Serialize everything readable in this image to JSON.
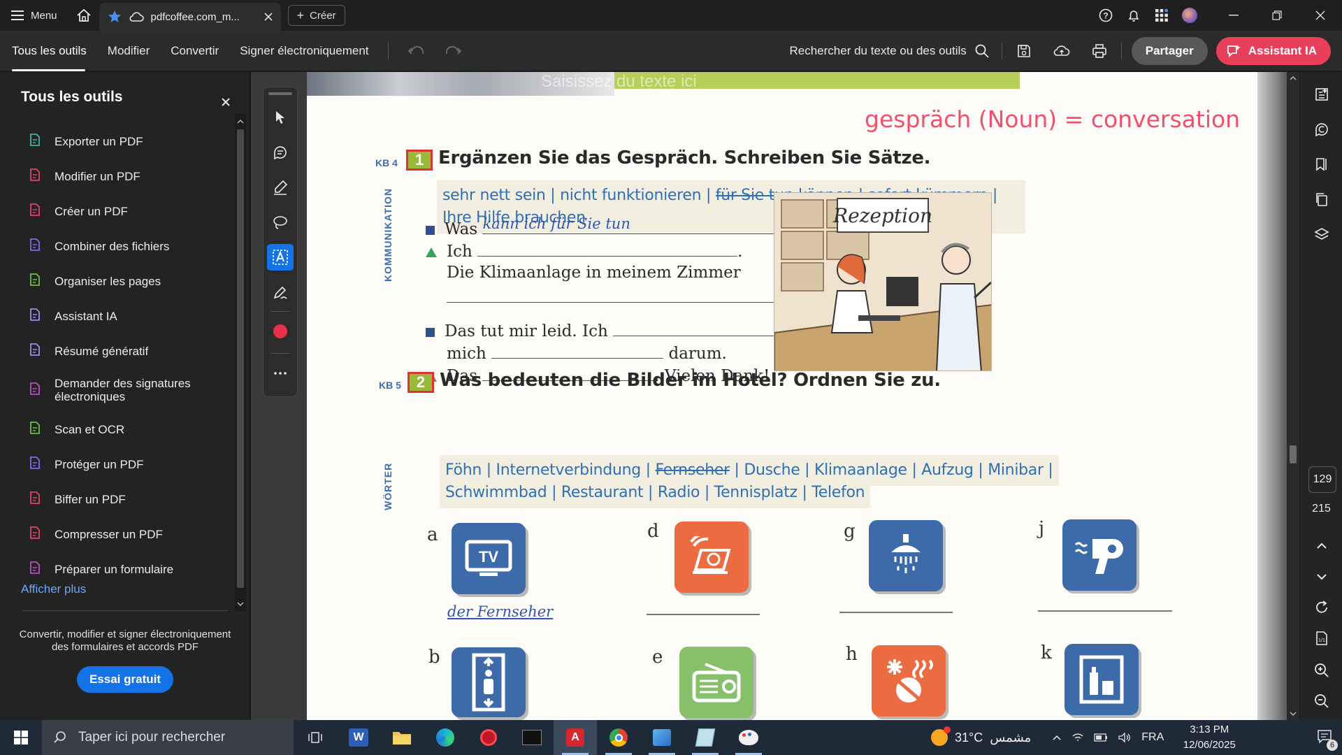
{
  "titlebar": {
    "menu_label": "Menu",
    "tab_title": "pdfcoffee.com_m...",
    "create_label": "Créer"
  },
  "toolbar": {
    "items": [
      "Tous les outils",
      "Modifier",
      "Convertir",
      "Signer électroniquement"
    ],
    "search_label": "Rechercher du texte ou des outils",
    "share_label": "Partager",
    "ai_label": "Assistant IA"
  },
  "left_panel": {
    "title": "Tous les outils",
    "items": [
      {
        "label": "Exporter un PDF",
        "icon": "export-pdf-icon",
        "color": "#3fb7a0"
      },
      {
        "label": "Modifier un PDF",
        "icon": "edit-pdf-icon",
        "color": "#e8406a"
      },
      {
        "label": "Créer un PDF",
        "icon": "create-pdf-icon",
        "color": "#e8406a"
      },
      {
        "label": "Combiner des fichiers",
        "icon": "combine-files-icon",
        "color": "#7a6cf0"
      },
      {
        "label": "Organiser les pages",
        "icon": "organize-pages-icon",
        "color": "#6cc040"
      },
      {
        "label": "Assistant IA",
        "icon": "ai-assistant-icon",
        "color": "#9c8cf0"
      },
      {
        "label": "Résumé génératif",
        "icon": "generative-summary-icon",
        "color": "#9c8cf0"
      },
      {
        "label": "Demander des signatures électroniques",
        "icon": "request-signatures-icon",
        "color": "#c04ac8"
      },
      {
        "label": "Scan et OCR",
        "icon": "scan-ocr-icon",
        "color": "#6cc040"
      },
      {
        "label": "Protéger un PDF",
        "icon": "protect-pdf-icon",
        "color": "#7a6cf0"
      },
      {
        "label": "Biffer un PDF",
        "icon": "redact-pdf-icon",
        "color": "#e8406a"
      },
      {
        "label": "Compresser un PDF",
        "icon": "compress-pdf-icon",
        "color": "#e8406a"
      },
      {
        "label": "Préparer un formulaire",
        "icon": "prepare-form-icon",
        "color": "#c04ac8"
      }
    ],
    "more_label": "Afficher plus",
    "promo_text": "Convertir, modifier et signer électroniquement des formulaires et accords PDF",
    "trial_label": "Essai gratuit"
  },
  "page": {
    "watermark": "Saisissez du texte ici",
    "annotation": "gespräch (Noun)  = conversation",
    "ex1": {
      "kb": "KB 4",
      "number": "1",
      "heading": "Ergänzen Sie das Gespräch. Schreiben Sie Sätze.",
      "side_label": "KOMMUNIKATION",
      "words": [
        "sehr nett sein",
        "nicht funktionieren",
        "für Sie tun können",
        "sofort kümmern",
        "Ihre Hilfe brauchen"
      ],
      "line1_a": "Was",
      "line1_hand": "kann ich für Sie tun",
      "line1_end": "?",
      "line2_a": "Ich",
      "line2_end": ".",
      "line3": "Die Klimaanlage in meinem Zimmer",
      "line3_end": ".",
      "line4_a": "Das tut mir leid. Ich",
      "line5_a": "mich",
      "line5_b": "darum.",
      "line6_a": "Das",
      "line6_b": ". Vielen Dank!",
      "sign": "Rezeption"
    },
    "ex2": {
      "kb": "KB 5",
      "number": "2",
      "heading": "Was bedeuten die Bilder im Hotel? Ordnen Sie zu.",
      "side_label": "WÖRTER",
      "words_row1": [
        "Föhn",
        "Internetverbindung",
        "Fernseher",
        "Dusche",
        "Klimaanlage",
        "Aufzug",
        "Minibar"
      ],
      "words_row2": [
        "Schwimmbad",
        "Restaurant",
        "Radio",
        "Tennisplatz",
        "Telefon"
      ],
      "letters": [
        "a",
        "d",
        "g",
        "j",
        "b",
        "e",
        "h",
        "k"
      ],
      "tv_label": "TV",
      "answer_a": "der Fernseher",
      "icon_colors": {
        "blue": "#3d6aa8",
        "orange": "#ec6b40",
        "green": "#86c06a"
      }
    }
  },
  "right_rail": {
    "current_page": "129",
    "total_pages": "215"
  },
  "taskbar": {
    "search_placeholder": "Taper ici pour rechercher",
    "weather_temp": "31°C",
    "weather_text": "مشمس",
    "language": "FRA",
    "time": "3:13 PM",
    "date": "12/06/2025",
    "notif_count": "6"
  },
  "colors": {
    "accent_blue": "#1473e6",
    "ai_red": "#e8405a",
    "annotation_red": "#f0506a"
  }
}
